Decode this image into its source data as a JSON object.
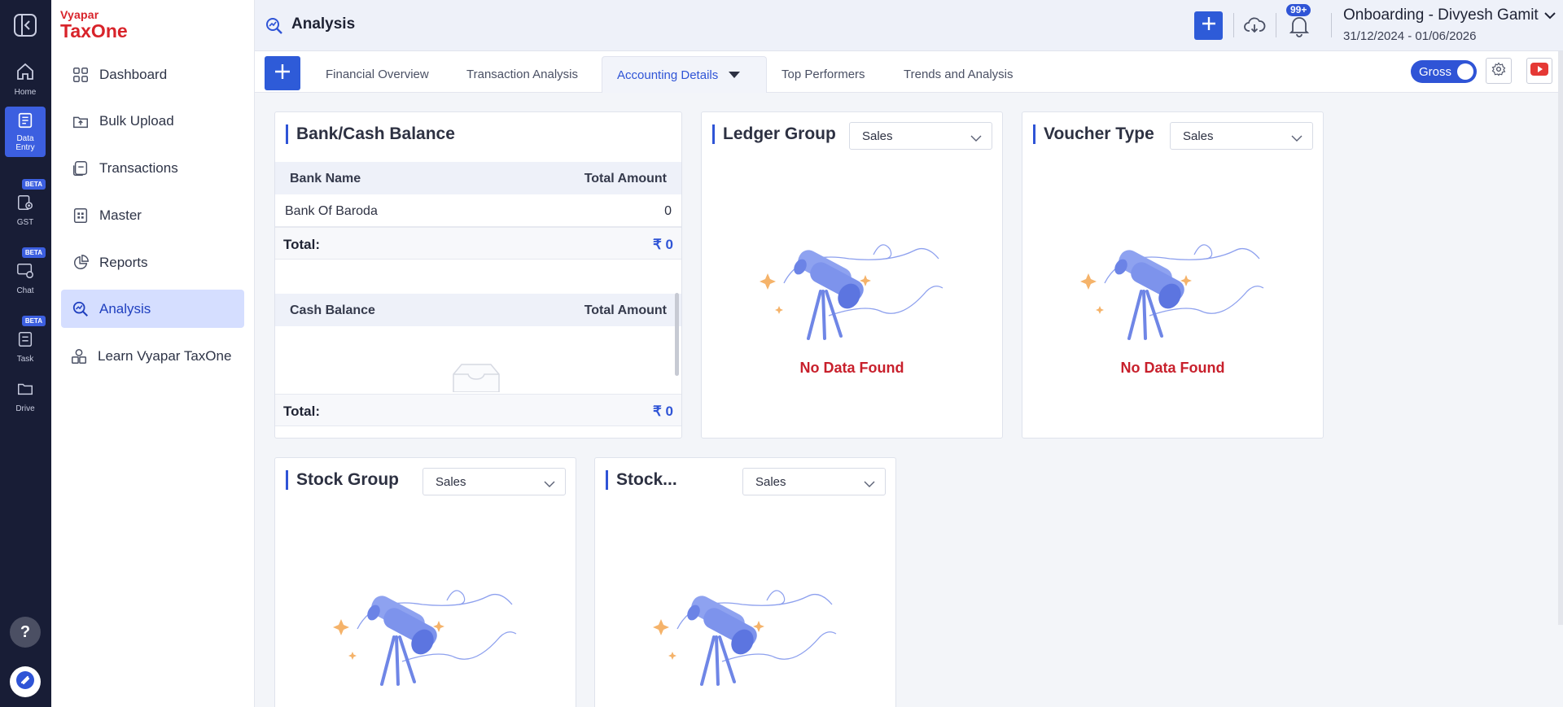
{
  "rail": {
    "items": [
      {
        "label": "Home",
        "icon": "home-icon"
      },
      {
        "label": "Data",
        "label2": "Entry",
        "icon": "data-entry-icon"
      },
      {
        "label": "GST",
        "icon": "gst-icon",
        "badge": "BETA"
      },
      {
        "label": "Chat",
        "icon": "chat-icon",
        "badge": "BETA"
      },
      {
        "label": "Task",
        "icon": "task-icon",
        "badge": "BETA"
      },
      {
        "label": "Drive",
        "icon": "drive-icon"
      }
    ],
    "help": "?"
  },
  "brand": {
    "top": "Vyapar",
    "bottom": "TaxOne"
  },
  "sidebar": {
    "items": [
      {
        "label": "Dashboard",
        "icon": "dashboard-icon"
      },
      {
        "label": "Bulk Upload",
        "icon": "bulk-upload-icon"
      },
      {
        "label": "Transactions",
        "icon": "transactions-icon"
      },
      {
        "label": "Master",
        "icon": "master-icon"
      },
      {
        "label": "Reports",
        "icon": "reports-icon"
      },
      {
        "label": "Analysis",
        "icon": "analysis-icon"
      },
      {
        "label": "Learn Vyapar TaxOne",
        "icon": "learn-icon"
      }
    ]
  },
  "header": {
    "title": "Analysis",
    "notification_count": "99+",
    "company": "Onboarding - Divyesh Gamit",
    "date_range": "31/12/2024 - 01/06/2026"
  },
  "tabs": {
    "items": [
      "Financial Overview",
      "Transaction Analysis",
      "Accounting Details",
      "Top Performers",
      "Trends and Analysis"
    ],
    "active": "Accounting Details",
    "gross_label": "Gross"
  },
  "bank_cash": {
    "title": "Bank/Cash Balance",
    "bank_header": {
      "name": "Bank Name",
      "amount": "Total Amount"
    },
    "bank_rows": [
      {
        "name": "Bank Of Baroda",
        "amount": "0"
      }
    ],
    "bank_total": {
      "label": "Total:",
      "value": "₹ 0"
    },
    "cash_header": {
      "name": "Cash Balance",
      "amount": "Total Amount"
    },
    "cash_total": {
      "label": "Total:",
      "value": "₹ 0"
    }
  },
  "ledger_group": {
    "title": "Ledger Group",
    "select": "Sales",
    "empty": "No Data Found"
  },
  "voucher_type": {
    "title": "Voucher Type",
    "select": "Sales",
    "empty": "No Data Found"
  },
  "stock_group": {
    "title": "Stock Group",
    "select": "Sales"
  },
  "stock_item": {
    "title": "Stock...",
    "select": "Sales"
  },
  "colors": {
    "primary": "#2f54d6",
    "rail": "#181d36",
    "nodata": "#c8202c",
    "brand": "#d8232a"
  }
}
